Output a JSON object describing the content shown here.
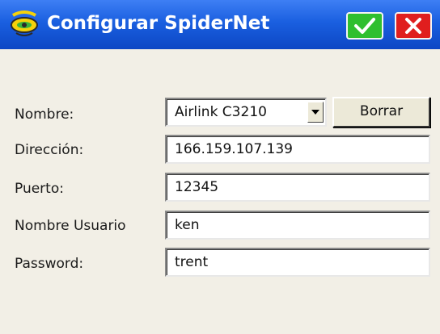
{
  "window": {
    "title": "Configurar SpiderNet",
    "icons": {
      "app": "spider-satellite-icon",
      "ok": "checkmark-icon",
      "close": "close-x-icon"
    },
    "colors": {
      "titlebar": "#1a5fe0",
      "ok_button": "#2fbf2f",
      "close_button": "#e01e1e",
      "background": "#f2efe6"
    }
  },
  "form": {
    "nombre": {
      "label": "Nombre:",
      "selected": "Airlink C3210"
    },
    "borrar_label": "Borrar",
    "direccion": {
      "label": "Dirección:",
      "value": "166.159.107.139"
    },
    "puerto": {
      "label": "Puerto:",
      "value": "12345"
    },
    "usuario": {
      "label": "Nombre Usuario",
      "value": "ken"
    },
    "password": {
      "label": "Password:",
      "value": "trent"
    }
  }
}
